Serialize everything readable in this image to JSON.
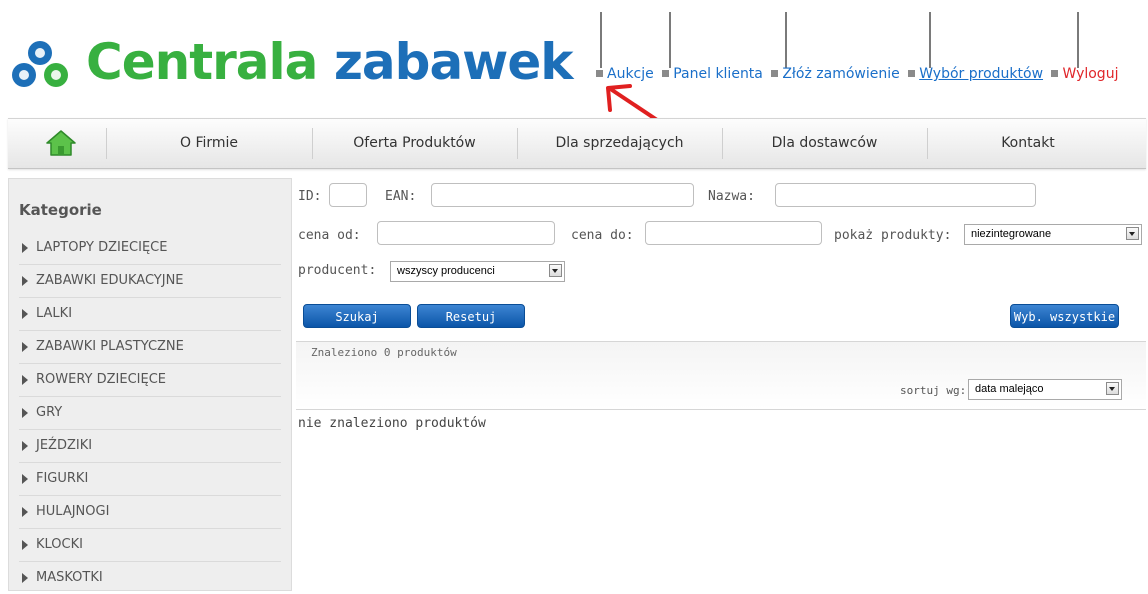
{
  "brand": {
    "name_part1": "Centrala",
    "name_part2": "zabawek"
  },
  "topnav": {
    "items": [
      {
        "label": "Aukcje"
      },
      {
        "label": "Panel klienta"
      },
      {
        "label": "Złóż zamówienie"
      },
      {
        "label": "Wybór produktów"
      },
      {
        "label": "Wyloguj"
      }
    ]
  },
  "menu": {
    "items": [
      {
        "label": "O Firmie"
      },
      {
        "label": "Oferta Produktów"
      },
      {
        "label": "Dla sprzedających"
      },
      {
        "label": "Dla dostawców"
      },
      {
        "label": "Kontakt"
      }
    ]
  },
  "sidebar": {
    "title": "Kategorie",
    "items": [
      {
        "label": "LAPTOPY DZIECIĘCE"
      },
      {
        "label": "ZABAWKI EDUKACYJNE"
      },
      {
        "label": "LALKI"
      },
      {
        "label": "ZABAWKI PLASTYCZNE"
      },
      {
        "label": "ROWERY DZIECIĘCE"
      },
      {
        "label": "GRY"
      },
      {
        "label": "JEŹDZIKI"
      },
      {
        "label": "FIGURKI"
      },
      {
        "label": "HULAJNOGI"
      },
      {
        "label": "KLOCKI"
      },
      {
        "label": "MASKOTKI"
      }
    ]
  },
  "search": {
    "id_label": "ID:",
    "id_value": "",
    "ean_label": "EAN:",
    "ean_value": "",
    "name_label": "Nazwa:",
    "name_value": "",
    "price_from_label": "cena od:",
    "price_from_value": "",
    "price_to_label": "cena do:",
    "price_to_value": "",
    "show_label": "pokaż produkty:",
    "show_value": "niezintegrowane",
    "producer_label": "producent:",
    "producer_value": "wszyscy producenci",
    "search_button": "Szukaj",
    "reset_button": "Resetuj",
    "select_all_button": "Wyb. wszystkie"
  },
  "results": {
    "found_text": "Znaleziono 0 produktów",
    "sort_label": "sortuj wg:",
    "sort_value": "data malejąco",
    "empty_text": "nie znaleziono produktów"
  },
  "colors": {
    "brand_green": "#38b040",
    "brand_blue": "#1d6fb8",
    "link_blue": "#1a6fc9",
    "logout_red": "#e0262a",
    "button_blue": "#0b55a8",
    "annotation_arrow": "#e02020"
  }
}
